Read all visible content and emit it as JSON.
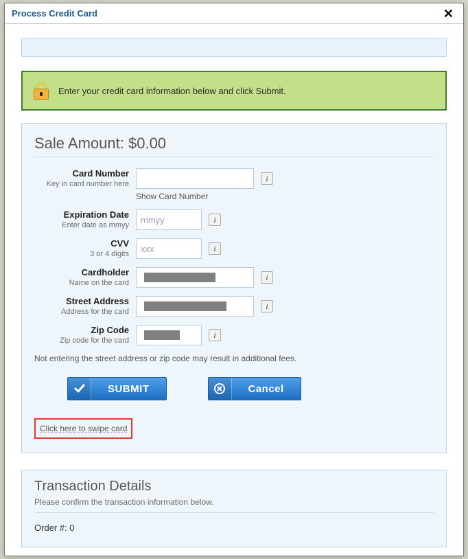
{
  "dialog": {
    "title": "Process Credit Card"
  },
  "alert": {
    "message": "Enter your credit card information below and click Submit."
  },
  "sale": {
    "title_prefix": "Sale Amount: ",
    "amount": "$0.00"
  },
  "fields": {
    "card_number": {
      "label": "Card Number",
      "hint": "Key in card number here",
      "value": "",
      "show_label": "Show Card Number"
    },
    "expiration": {
      "label": "Expiration Date",
      "hint": "Enter date as mmyy",
      "placeholder": "mmyy",
      "value": ""
    },
    "cvv": {
      "label": "CVV",
      "hint": "3 or 4 digits",
      "placeholder": "xxx",
      "value": ""
    },
    "cardholder": {
      "label": "Cardholder",
      "hint": "Name on the card",
      "value": ""
    },
    "street": {
      "label": "Street Address",
      "hint": "Address for the card",
      "value": ""
    },
    "zip": {
      "label": "Zip Code",
      "hint": "Zip code for the card",
      "value": ""
    }
  },
  "notes": {
    "fee_warning": "Not entering the street address or zip code may result in additional fees."
  },
  "buttons": {
    "submit": "SUBMIT",
    "cancel": "Cancel"
  },
  "swipe": {
    "label": "Click here to swipe card"
  },
  "transaction": {
    "title": "Transaction Details",
    "subtitle": "Please confirm the transaction information below.",
    "order_label": "Order #: ",
    "order_number": "0"
  }
}
